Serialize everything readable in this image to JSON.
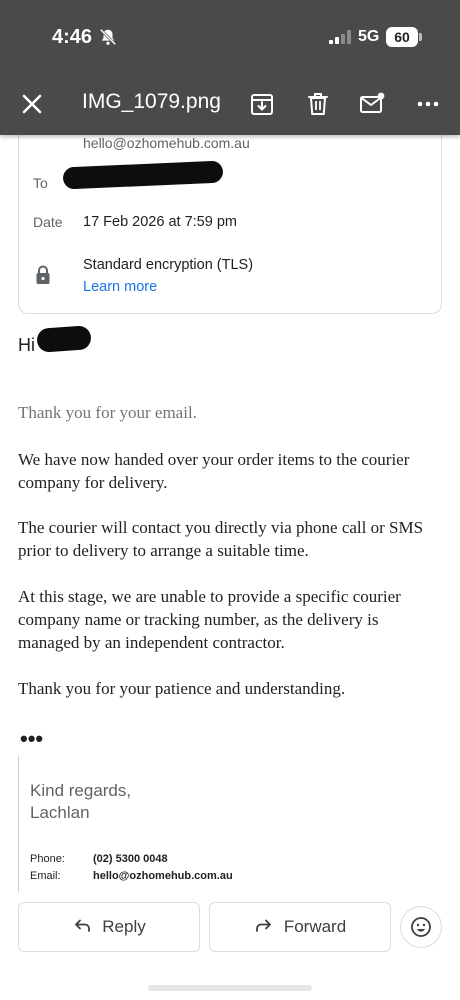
{
  "status": {
    "time": "4:46",
    "network": "5G",
    "battery": "60"
  },
  "appbar": {
    "title": "IMG_1079.png",
    "icons": [
      "close-icon",
      "archive-icon",
      "delete-icon",
      "mark-unread-icon",
      "more-icon"
    ]
  },
  "header_card": {
    "from_email": "hello@ozhomehub.com.au",
    "to_label": "To",
    "date_label": "Date",
    "date_value": "17 Feb 2026 at 7:59 pm",
    "encryption": "Standard encryption (TLS)",
    "learn_more": "Learn more"
  },
  "message": {
    "greeting": "Hi",
    "paragraphs": [
      "Thank you for your email.",
      "We have now handed over your order items to the courier company for delivery.",
      "The courier will contact you directly via phone call or SMS prior to delivery to arrange a suitable time.",
      "At this stage, we are unable to provide a specific courier company name or tracking number, as the delivery is managed by an independent contractor.",
      "Thank you for your patience and understanding."
    ],
    "ellipsis": "•••"
  },
  "signature": {
    "regards": "Kind regards,",
    "name": "Lachlan",
    "phone_label": "Phone:",
    "phone_value": "(02) 5300 0048",
    "email_label": "Email:",
    "email_value": "hello@ozhomehub.com.au"
  },
  "actions": {
    "reply": "Reply",
    "forward": "Forward",
    "emoji_icon": "emoji-reaction-icon"
  },
  "colors": {
    "header_bg": "#4a4a4a",
    "link": "#1a73e8",
    "border": "#dadce0"
  }
}
